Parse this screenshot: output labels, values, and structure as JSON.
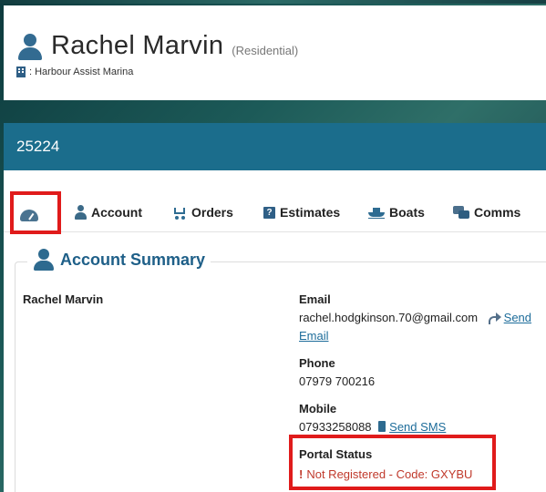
{
  "header": {
    "name": "Rachel Marvin",
    "type": "(Residential)",
    "marina": ": Harbour Assist Marina"
  },
  "account_id": "25224",
  "tabs": [
    {
      "label": "",
      "icon": "dashboard-gauge-icon"
    },
    {
      "label": "Account",
      "icon": "user-icon"
    },
    {
      "label": "Orders",
      "icon": "cart-icon"
    },
    {
      "label": "Estimates",
      "icon": "question-icon"
    },
    {
      "label": "Boats",
      "icon": "boat-icon"
    },
    {
      "label": "Comms",
      "icon": "comments-icon"
    }
  ],
  "summary": {
    "title": "Account Summary",
    "account_name": "Rachel Marvin",
    "email_label": "Email",
    "email_value": "rachel.hodgkinson.70@gmail.com",
    "send_email_part1": "Send",
    "send_email_part2": "Email",
    "phone_label": "Phone",
    "phone_value": "07979 700216",
    "mobile_label": "Mobile",
    "mobile_value": "07933258088",
    "send_sms": "Send SMS",
    "portal_label": "Portal Status",
    "portal_value": "Not Registered - Code: GXYBU",
    "portal_mark": "!"
  },
  "colors": {
    "accent": "#1b6d8c",
    "heading": "#1e5f88",
    "error": "#c0392b",
    "highlight": "#e01b1b"
  }
}
